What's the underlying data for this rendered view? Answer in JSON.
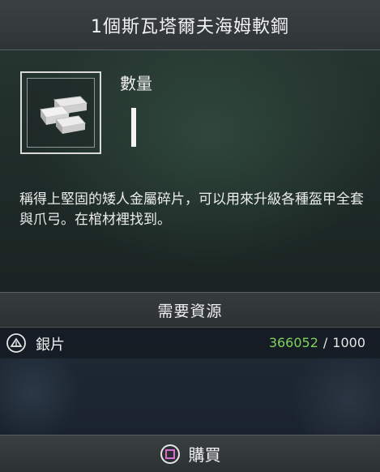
{
  "header": {
    "title": "1個斯瓦塔爾夫海姆軟鋼"
  },
  "item": {
    "icon": "metal-ingot-icon",
    "quantity_label": "數量",
    "description": "稱得上堅固的矮人金屬碎片，可以用來升級各種盔甲全套與爪弓。在棺材裡找到。"
  },
  "requirements": {
    "header": "需要資源",
    "resources": [
      {
        "icon": "silver-icon",
        "name": "銀片",
        "have": "366052",
        "separator": "/",
        "cost": "1000"
      }
    ]
  },
  "footer": {
    "button_icon": "square-button-icon",
    "buy_label": "購買"
  },
  "colors": {
    "have_amount": "#7fd35a",
    "button_accent": "#d86fc8"
  }
}
